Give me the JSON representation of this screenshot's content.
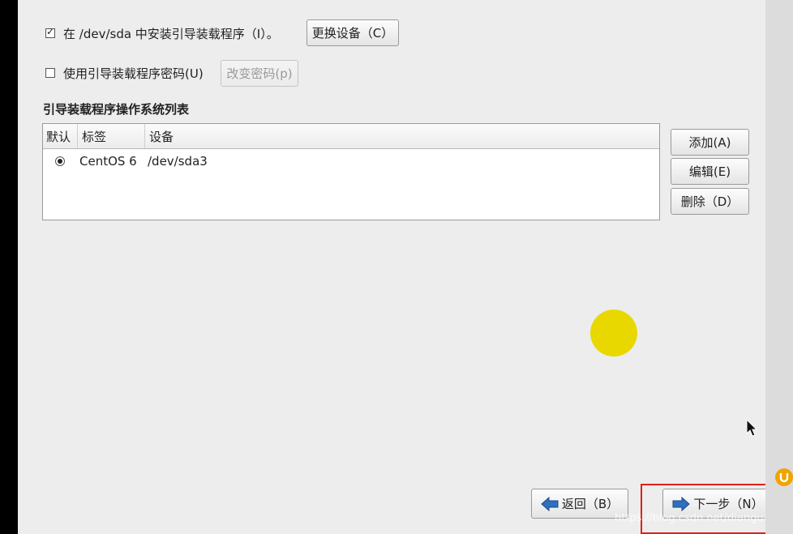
{
  "options": {
    "install_bootloader": {
      "checked": true,
      "label": "在 /dev/sda 中安装引导装载程序（I）。",
      "button": "更换设备（C）"
    },
    "bootloader_password": {
      "checked": false,
      "label": "使用引导装载程序密码(U)",
      "button": "改变密码(p)"
    }
  },
  "os_list": {
    "title": "引导装载程序操作系统列表",
    "columns": [
      "默认",
      "标签",
      "设备"
    ],
    "rows": [
      {
        "default": true,
        "label": "CentOS 6",
        "device": "/dev/sda3"
      }
    ],
    "actions": {
      "add": "添加(A)",
      "edit": "编辑(E)",
      "delete": "删除（D）"
    }
  },
  "nav": {
    "back": "返回（B）",
    "next": "下一步（N）"
  },
  "watermark": "https://blog.csdn.net/dianguan",
  "colors": {
    "highlight": "#e0201c",
    "marker": "#e8d800",
    "arrow_blue": "#2f6fc0"
  }
}
